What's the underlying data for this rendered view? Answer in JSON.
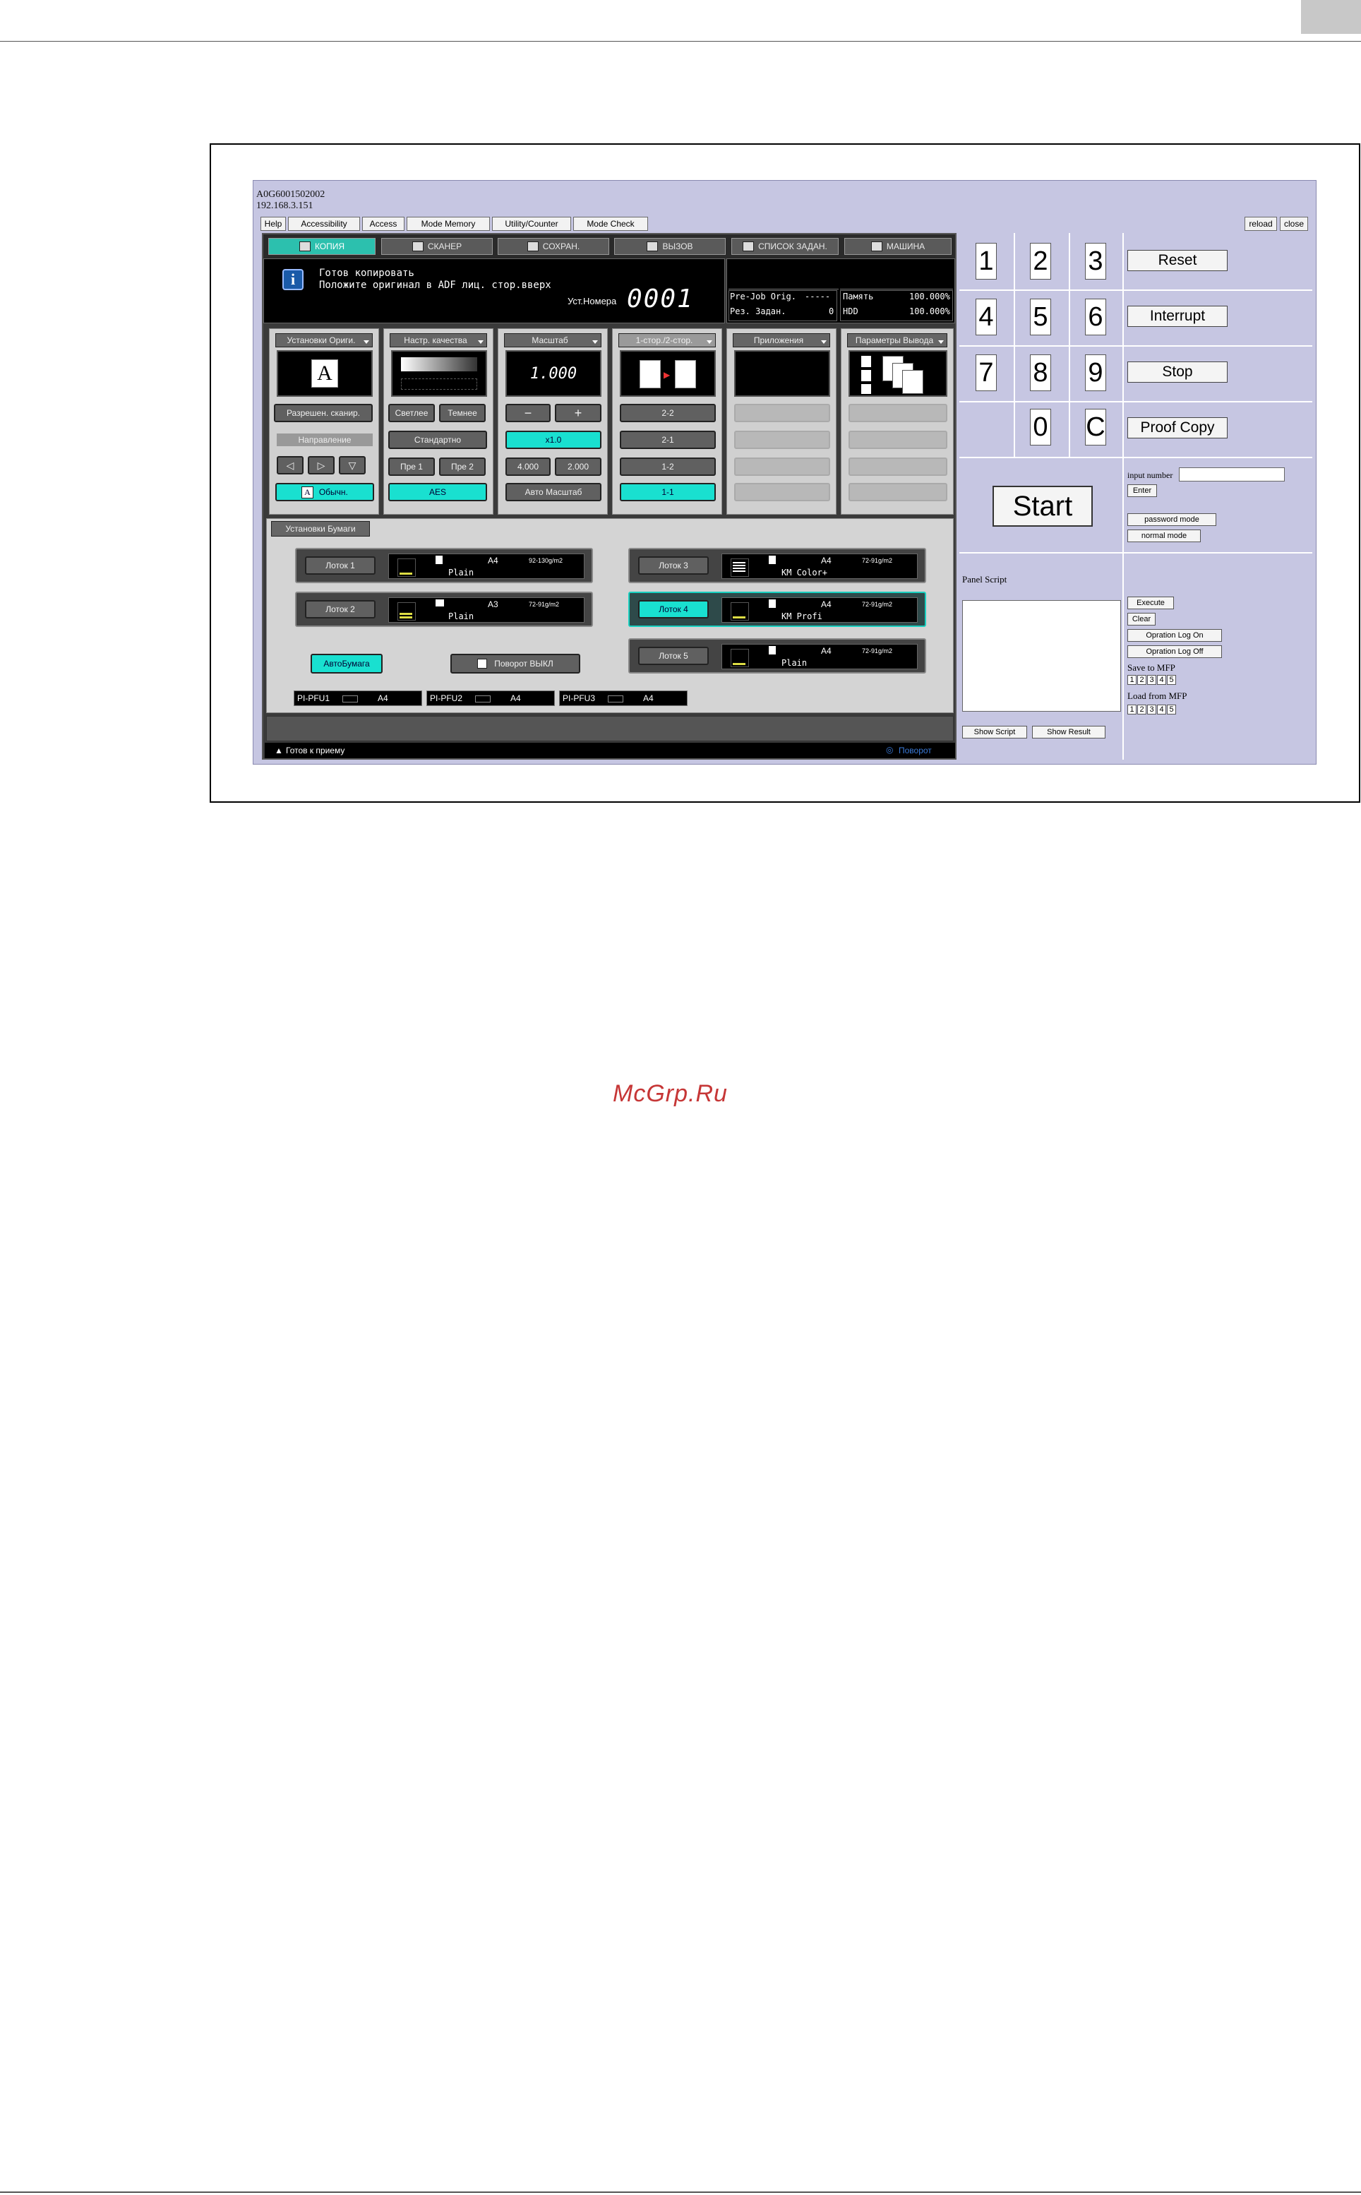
{
  "page": {
    "watermark": "McGrp.Ru"
  },
  "device": {
    "id": "A0G6001502002",
    "ip": "192.168.3.151"
  },
  "menu": [
    "Help",
    "Accessibility",
    "Access",
    "Mode Memory",
    "Utility/Counter",
    "Mode Check"
  ],
  "window_buttons": {
    "reload": "reload",
    "close": "close"
  },
  "tabs": [
    "КОПИЯ",
    "СКАНЕР",
    "СОХРАН.",
    "ВЫЗОВ",
    "СПИСОК ЗАДАН.",
    "МАШИНА"
  ],
  "message": {
    "line1": "Готов копировать",
    "line2": "Положите оригинал в ADF лиц. стор.вверх",
    "count_label": "Уст.Номера",
    "count": "0001"
  },
  "counters": {
    "prejob_label": "Pre-Job Orig.",
    "prejob_value": "-----",
    "memory_label": "Память",
    "memory_value": "100.000%",
    "reserve_label": "Рез. Задан.",
    "reserve_value": "0",
    "hdd_label": "HDD",
    "hdd_value": "100.000%"
  },
  "settings": {
    "original": {
      "title": "Установки Ориги.",
      "scan_btn": "Разрешен. сканир.",
      "direction": "Направление",
      "normal": "Обычн."
    },
    "quality": {
      "title": "Настр. качества",
      "lighter": "Светлее",
      "darker": "Темнее",
      "standard": "Стандартно",
      "pre1": "Пре 1",
      "pre2": "Пре 2",
      "aes": "AES"
    },
    "zoom": {
      "title": "Масштаб",
      "value": "1.000",
      "minus": "−",
      "plus": "+",
      "x1": "x1.0",
      "v4": "4.000",
      "v2": "2.000",
      "auto": "Авто Масштаб"
    },
    "duplex": {
      "title": "1-стор./2-стор.",
      "o1": "2-2",
      "o2": "2-1",
      "o3": "1-2",
      "o4": "1-1"
    },
    "apps": {
      "title": "Приложения"
    },
    "output": {
      "title": "Параметры Вывода"
    }
  },
  "paper": {
    "title": "Установки Бумаги",
    "trays": [
      {
        "label": "Лоток 1",
        "size": "A4",
        "weight": "92-130g/m2",
        "type": "Plain"
      },
      {
        "label": "Лоток 2",
        "size": "A3",
        "weight": "72-91g/m2",
        "type": "Plain"
      },
      {
        "label": "Лоток 3",
        "size": "A4",
        "weight": "72-91g/m2",
        "type": "KM Color+"
      },
      {
        "label": "Лоток 4",
        "size": "A4",
        "weight": "72-91g/m2",
        "type": "KM Profi"
      },
      {
        "label": "Лоток 5",
        "size": "A4",
        "weight": "72-91g/m2",
        "type": "Plain"
      }
    ],
    "auto_paper": "АвтоБумага",
    "rotate": "Поворот ВЫКЛ",
    "pfu": [
      {
        "label": "PI-PFU1",
        "size": "A4"
      },
      {
        "label": "PI-PFU2",
        "size": "A4"
      },
      {
        "label": "PI-PFU3",
        "size": "A4"
      }
    ]
  },
  "status": {
    "left": "Готов к приему",
    "right": "Поворот"
  },
  "keypad": [
    "1",
    "2",
    "3",
    "4",
    "5",
    "6",
    "7",
    "8",
    "9",
    "0",
    "C"
  ],
  "commands": {
    "reset": "Reset",
    "interrupt": "Interrupt",
    "stop": "Stop",
    "proof": "Proof Copy",
    "start": "Start"
  },
  "side": {
    "input_label": "input number",
    "enter": "Enter",
    "password_mode": "password mode",
    "normal_mode": "normal mode",
    "execute": "Execute",
    "clear": "Clear",
    "log_on": "Opration Log On",
    "log_off": "Opration Log Off",
    "save_label": "Save to MFP",
    "load_label": "Load from MFP",
    "slots": [
      "1",
      "2",
      "3",
      "4",
      "5"
    ],
    "panel_script": "Panel Script",
    "show_script": "Show Script",
    "show_result": "Show Result"
  }
}
